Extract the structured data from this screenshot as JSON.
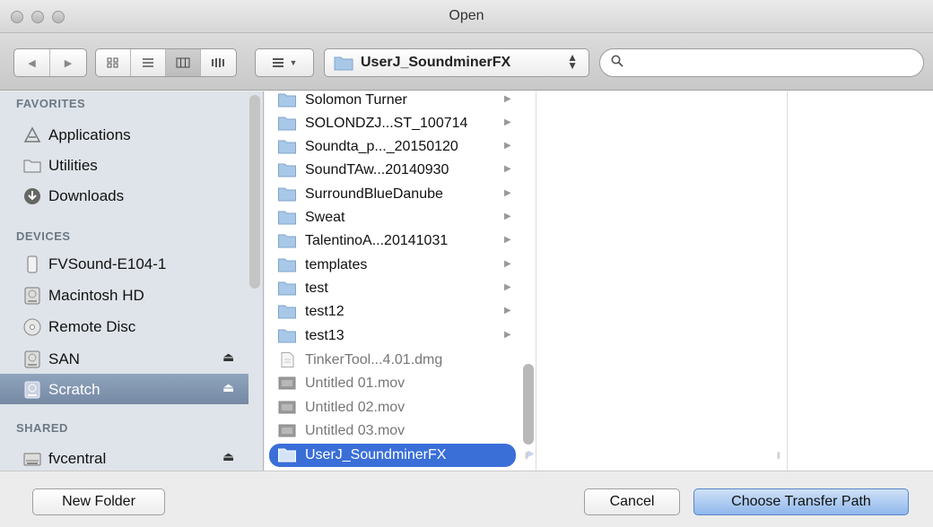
{
  "window": {
    "title": "Open"
  },
  "toolbar": {
    "back_label": "◀",
    "forward_label": "▶",
    "view_icons": [
      "icon-view-icon",
      "list-view-icon",
      "column-view-icon",
      "coverflow-view-icon"
    ],
    "path": "UserJ_SoundminerFX",
    "search_value": ""
  },
  "sidebar": {
    "sections": [
      {
        "title": "FAVORITES",
        "items": [
          {
            "label": "Applications",
            "icon": "applications-icon"
          },
          {
            "label": "Utilities",
            "icon": "folder-icon"
          },
          {
            "label": "Downloads",
            "icon": "downloads-icon"
          }
        ]
      },
      {
        "title": "DEVICES",
        "items": [
          {
            "label": "FVSound-E104-1",
            "icon": "computer-icon"
          },
          {
            "label": "Macintosh HD",
            "icon": "hard-disk-icon"
          },
          {
            "label": "Remote Disc",
            "icon": "disc-icon"
          },
          {
            "label": "SAN",
            "icon": "hard-disk-icon",
            "eject": true
          },
          {
            "label": "Scratch",
            "icon": "hard-disk-icon",
            "eject": true,
            "selected": true
          }
        ]
      },
      {
        "title": "SHARED",
        "items": [
          {
            "label": "fvcentral",
            "icon": "server-icon",
            "eject": true
          }
        ]
      }
    ]
  },
  "browser": {
    "items": [
      {
        "name": "Solomon Turner",
        "type": "folder"
      },
      {
        "name": "SOLONDZJ...ST_100714",
        "type": "folder"
      },
      {
        "name": "Soundta_p..._20150120",
        "type": "folder"
      },
      {
        "name": "SoundTAw...20140930",
        "type": "folder"
      },
      {
        "name": "SurroundBlueDanube",
        "type": "folder"
      },
      {
        "name": "Sweat",
        "type": "folder"
      },
      {
        "name": "TalentinoA...20141031",
        "type": "folder"
      },
      {
        "name": "templates",
        "type": "folder"
      },
      {
        "name": "test",
        "type": "folder"
      },
      {
        "name": "test12",
        "type": "folder"
      },
      {
        "name": "test13",
        "type": "folder"
      },
      {
        "name": "TinkerTool...4.01.dmg",
        "type": "file"
      },
      {
        "name": "Untitled 01.mov",
        "type": "movie"
      },
      {
        "name": "Untitled 02.mov",
        "type": "movie"
      },
      {
        "name": "Untitled 03.mov",
        "type": "movie"
      },
      {
        "name": "UserJ_SoundminerFX",
        "type": "folder",
        "selected": true
      }
    ]
  },
  "buttons": {
    "new_folder": "New Folder",
    "cancel": "Cancel",
    "choose": "Choose Transfer Path"
  },
  "eject_symbol": "⏏",
  "disclosure_symbol": "▶",
  "colors": {
    "selection_blue": "#3a6fd8",
    "sidebar_selection": "#7f93ad",
    "sidebar_bg": "#dfe4ea"
  }
}
